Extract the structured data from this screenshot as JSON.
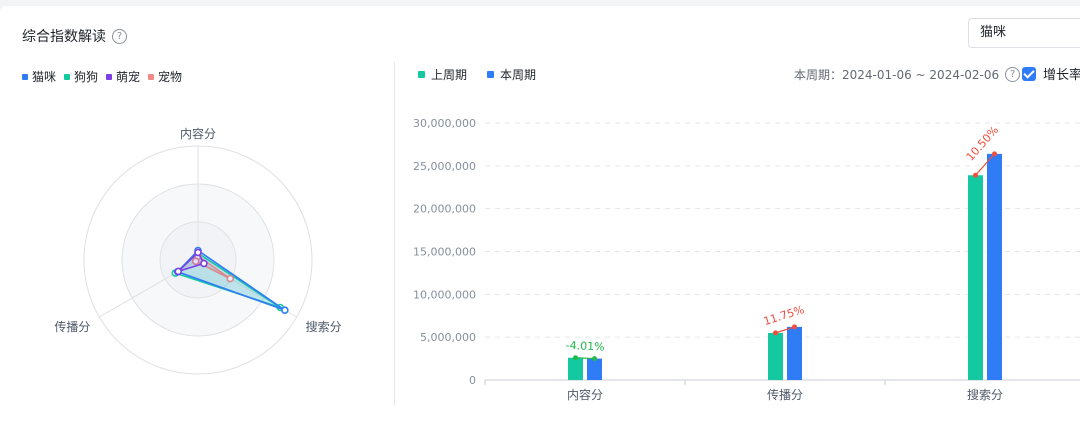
{
  "header": {
    "title": "综合指数解读",
    "help_icon": "question-circle-icon"
  },
  "search": {
    "value": "猫咪"
  },
  "radar": {
    "legend": [
      {
        "label": "猫咪",
        "color": "#2f7cf6"
      },
      {
        "label": "狗狗",
        "color": "#14c9a0"
      },
      {
        "label": "萌宠",
        "color": "#7b3fe4"
      },
      {
        "label": "宠物",
        "color": "#f08a83"
      }
    ]
  },
  "bar": {
    "legend": [
      {
        "label": "上周期",
        "color": "#14c9a0"
      },
      {
        "label": "本周期",
        "color": "#2f7cf6"
      }
    ],
    "period_label": "本周期：2024-01-06 ~ 2024-02-06",
    "growth_toggle": {
      "label": "增长率",
      "checked": true
    }
  },
  "chart_data": [
    {
      "type": "radar",
      "indicators": [
        "内容分",
        "搜索分",
        "传播分"
      ],
      "max": 30000000,
      "series": [
        {
          "name": "猫咪",
          "values": [
            2500000,
            26400000,
            6200000
          ]
        },
        {
          "name": "狗狗",
          "values": [
            1800000,
            25000000,
            6900000
          ]
        },
        {
          "name": "萌宠",
          "values": [
            2000000,
            1800000,
            6000000
          ]
        },
        {
          "name": "宠物",
          "values": [
            1000000,
            9800000,
            700000
          ]
        }
      ]
    },
    {
      "type": "bar",
      "categories": [
        "内容分",
        "传播分",
        "搜索分"
      ],
      "series": [
        {
          "name": "上周期",
          "values": [
            2600000,
            5500000,
            23900000
          ]
        },
        {
          "name": "本周期",
          "values": [
            2500000,
            6200000,
            26400000
          ]
        }
      ],
      "growth_labels": [
        "-4.01%",
        "11.75%",
        "10.50%"
      ],
      "growth_colors": [
        "#22b84a",
        "#f04e3e",
        "#f04e3e"
      ],
      "y_ticks": [
        "0",
        "5,000,000",
        "10,000,000",
        "15,000,000",
        "20,000,000",
        "25,000,000",
        "30,000,000"
      ],
      "ylim": [
        0,
        30000000
      ],
      "grid": true
    }
  ]
}
